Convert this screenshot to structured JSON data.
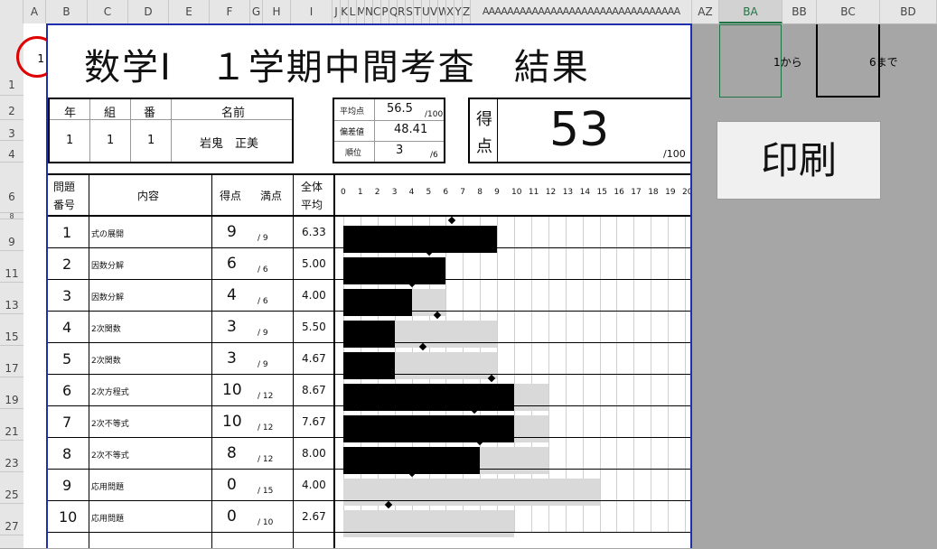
{
  "column_headers": [
    "A",
    "B",
    "C",
    "D",
    "E",
    "F",
    "G",
    "H",
    "I",
    "J",
    "K",
    "L",
    "M",
    "N",
    "C",
    "P",
    "Q",
    "R",
    "S",
    "T",
    "U",
    "V",
    "W",
    "X",
    "Y",
    "Z",
    "AAAAAAAAAAAAAAAAAAAAAAAAAAAAAAAA",
    "AZ",
    "BA",
    "BB",
    "BC",
    "BD"
  ],
  "row_headers": [
    "1",
    "2",
    "3",
    "4",
    "6",
    "8",
    "9",
    "11",
    "13",
    "15",
    "17",
    "19",
    "21",
    "23",
    "25",
    "27"
  ],
  "cell_a1": "1",
  "title": "数学Ⅰ　１学期中間考査　結果",
  "student": {
    "headers": [
      "年",
      "組",
      "番",
      "名前"
    ],
    "values": [
      "1",
      "1",
      "1",
      "岩鬼　正美"
    ]
  },
  "stats": {
    "labels": [
      "平均点",
      "偏差値",
      "順位"
    ],
    "values": [
      "56.5",
      "48.41",
      "3"
    ],
    "suffix_avg": "/100",
    "suffix_rank": "/6"
  },
  "score": {
    "label_top": "得",
    "label_bottom": "点",
    "value": "53",
    "suffix": "/100"
  },
  "table_headers": {
    "num_line1": "問題",
    "num_line2": "番号",
    "content": "内容",
    "score": "得点",
    "max": "満点",
    "avg_line1": "全体",
    "avg_line2": "平均"
  },
  "scale_ticks": [
    "0",
    "1",
    "2",
    "3",
    "4",
    "5",
    "6",
    "7",
    "8",
    "9",
    "10",
    "11",
    "12",
    "13",
    "14",
    "15",
    "16",
    "17",
    "18",
    "19",
    "20"
  ],
  "questions": [
    {
      "num": "1",
      "content": "式の展開",
      "score": "9",
      "max": "/ 9",
      "avg": "6.33"
    },
    {
      "num": "2",
      "content": "因数分解",
      "score": "6",
      "max": "/ 6",
      "avg": "5.00"
    },
    {
      "num": "3",
      "content": "因数分解",
      "score": "4",
      "max": "/ 6",
      "avg": "4.00"
    },
    {
      "num": "4",
      "content": "2次関数",
      "score": "3",
      "max": "/ 9",
      "avg": "5.50"
    },
    {
      "num": "5",
      "content": "2次関数",
      "score": "3",
      "max": "/ 9",
      "avg": "4.67"
    },
    {
      "num": "6",
      "content": "2次方程式",
      "score": "10",
      "max": "/ 12",
      "avg": "8.67"
    },
    {
      "num": "7",
      "content": "2次不等式",
      "score": "10",
      "max": "/ 12",
      "avg": "7.67"
    },
    {
      "num": "8",
      "content": "2次不等式",
      "score": "8",
      "max": "/ 12",
      "avg": "8.00"
    },
    {
      "num": "9",
      "content": "応用問題",
      "score": "0",
      "max": "/ 15",
      "avg": "4.00"
    },
    {
      "num": "10",
      "content": "応用問題",
      "score": "0",
      "max": "/ 10",
      "avg": "2.67"
    }
  ],
  "chart_data": {
    "type": "bar",
    "categories": [
      "1",
      "2",
      "3",
      "4",
      "5",
      "6",
      "7",
      "8",
      "9",
      "10"
    ],
    "series": [
      {
        "values": [
          9,
          6,
          4,
          3,
          3,
          10,
          10,
          8,
          0,
          0
        ]
      },
      {
        "values": [
          9,
          6,
          6,
          9,
          9,
          12,
          12,
          12,
          15,
          10
        ]
      },
      {
        "values": [
          6.33,
          5.0,
          4.0,
          5.5,
          4.67,
          8.67,
          7.67,
          8.0,
          4.0,
          2.67
        ]
      }
    ],
    "xlim": [
      0,
      20
    ],
    "orientation": "horizontal",
    "grid": true
  },
  "range": {
    "from_value": "1",
    "from_label": "から",
    "to_value": "6",
    "to_label": "まで"
  },
  "print_button": "印刷"
}
